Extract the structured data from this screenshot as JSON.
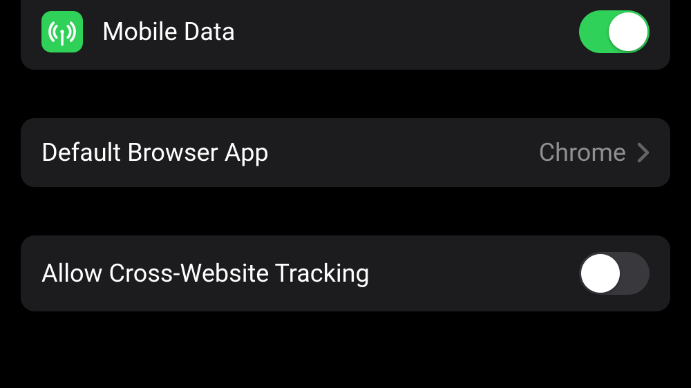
{
  "group1": {
    "mobileData": {
      "label": "Mobile Data",
      "toggleOn": true,
      "iconColor": "#30d158"
    }
  },
  "group2": {
    "defaultBrowser": {
      "label": "Default Browser App",
      "value": "Chrome"
    }
  },
  "group3": {
    "crossWebsiteTracking": {
      "label": "Allow Cross-Website Tracking",
      "toggleOn": false
    }
  }
}
